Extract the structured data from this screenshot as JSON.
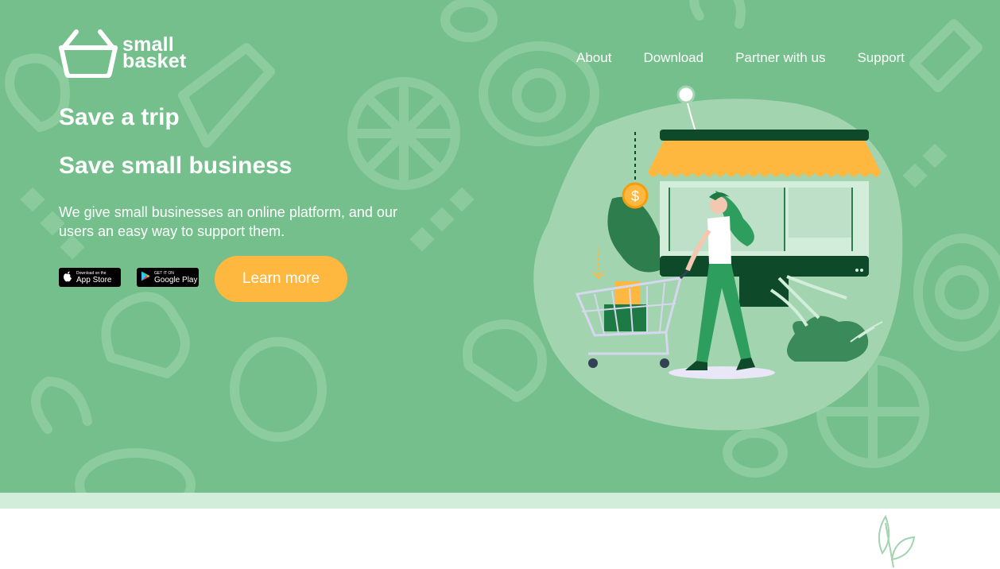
{
  "logo": {
    "line1": "small",
    "line2": "basket",
    "icon": "basket-icon"
  },
  "nav": {
    "items": [
      "About",
      "Download",
      "Partner with us",
      "Support"
    ]
  },
  "hero": {
    "title1": "Save a trip",
    "title2": "Save small business",
    "tagline": "We give small businesses an online platform, and our users an easy way to support them.",
    "learn_more": "Learn more"
  },
  "stores": {
    "app_store": {
      "small": "Download on the",
      "big": "App Store",
      "icon": "apple-icon"
    },
    "google_play": {
      "small": "GET IT ON",
      "big": "Google Play",
      "icon": "play-icon"
    }
  },
  "colors": {
    "hero_bg": "#74bf8b",
    "accent": "#ffb83f",
    "band": "#d3eddb",
    "dark_green": "#0e4a2a"
  }
}
